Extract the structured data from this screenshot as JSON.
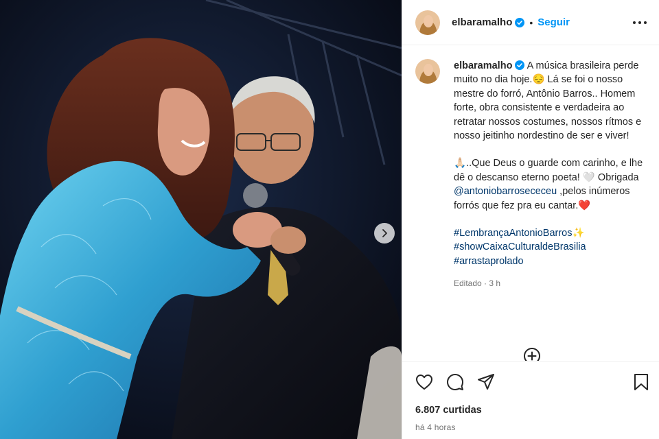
{
  "post": {
    "username": "elbaramalho",
    "follow_label": "Seguir",
    "separator": "•",
    "caption": {
      "username": "elbaramalho",
      "paragraph1": "A música brasileira perde muito no dia hoje.😔  Lá se foi o nosso mestre do forró, Antônio Barros.. Homem forte, obra consistente e verdadeira ao retratar nossos costumes, nossos rítmos e nosso jeitinho nordestino de ser e viver!",
      "paragraph2_part1": "🙏🏻..Que Deus o guarde com carinho, e lhe dê o descanso eterno poeta! 🤍 Obrigada ",
      "mention": "@antoniobarrosececeu",
      "paragraph2_part2": " ,pelos inúmeros forrós que fez pra eu cantar.❤️",
      "hashtags": [
        "#LembrançaAntonioBarros✨",
        "#showCaixaCulturaldeBrasilia",
        "#arrastaprolado"
      ]
    },
    "edited_label": "Editado · 3 h",
    "likes": "6.807 curtidas",
    "time": "há 4 horas"
  },
  "icons": {
    "verified": "verified-badge-icon",
    "more": "more-options-icon",
    "next": "chevron-right-icon",
    "like": "heart-icon",
    "comment": "comment-icon",
    "share": "share-icon",
    "save": "bookmark-icon",
    "load_more": "plus-circle-icon"
  },
  "colors": {
    "link": "#00376b",
    "follow": "#0095f6",
    "verified": "#0095f6",
    "secondary_text": "#737373"
  }
}
